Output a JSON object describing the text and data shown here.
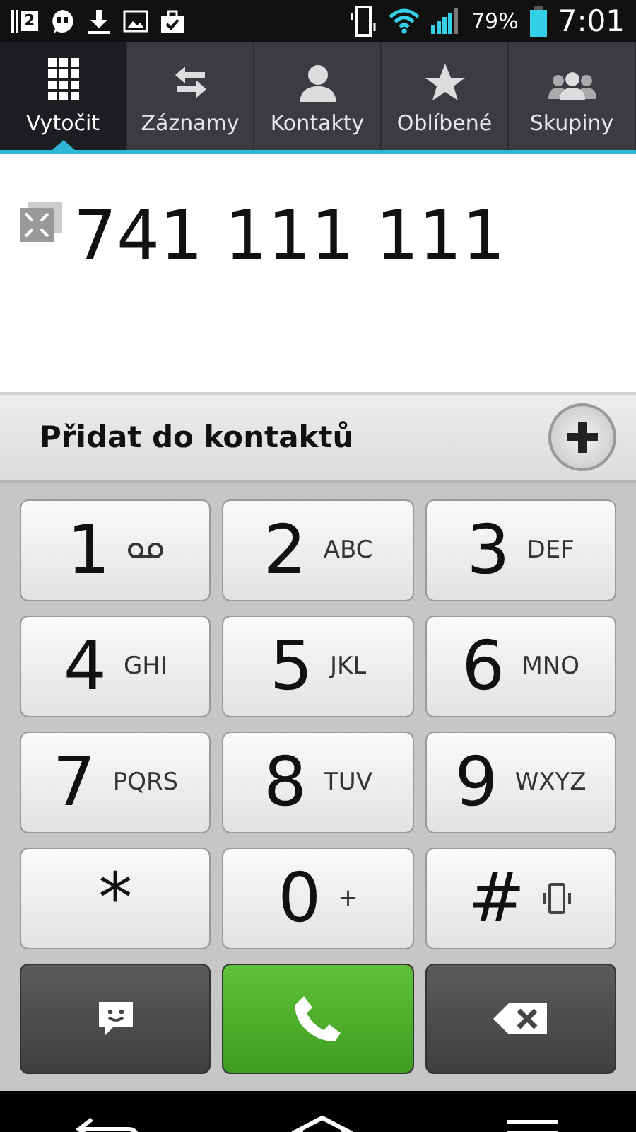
{
  "status_bar": {
    "notification_count": "2",
    "battery": "79%",
    "time": "7:01"
  },
  "tabs": [
    {
      "label": "Vytočit",
      "selected": true
    },
    {
      "label": "Záznamy",
      "selected": false
    },
    {
      "label": "Kontakty",
      "selected": false
    },
    {
      "label": "Oblíbené",
      "selected": false
    },
    {
      "label": "Skupiny",
      "selected": false
    }
  ],
  "number": "741 111 111",
  "add_contact": {
    "label": "Přidat do kontaktů"
  },
  "keys": [
    {
      "digit": "1",
      "kind": "voicemail"
    },
    {
      "digit": "2",
      "kind": "letters",
      "sub": "ABC"
    },
    {
      "digit": "3",
      "kind": "letters",
      "sub": "DEF"
    },
    {
      "digit": "4",
      "kind": "letters",
      "sub": "GHI"
    },
    {
      "digit": "5",
      "kind": "letters",
      "sub": "JKL"
    },
    {
      "digit": "6",
      "kind": "letters",
      "sub": "MNO"
    },
    {
      "digit": "7",
      "kind": "letters",
      "sub": "PQRS"
    },
    {
      "digit": "8",
      "kind": "letters",
      "sub": "TUV"
    },
    {
      "digit": "9",
      "kind": "letters",
      "sub": "WXYZ"
    },
    {
      "digit": "*",
      "kind": "plain"
    },
    {
      "digit": "0",
      "kind": "letters",
      "sub": "+"
    },
    {
      "digit": "#",
      "kind": "vibrate"
    }
  ],
  "actions": [
    {
      "kind": "message"
    },
    {
      "kind": "call"
    },
    {
      "kind": "delete"
    }
  ]
}
